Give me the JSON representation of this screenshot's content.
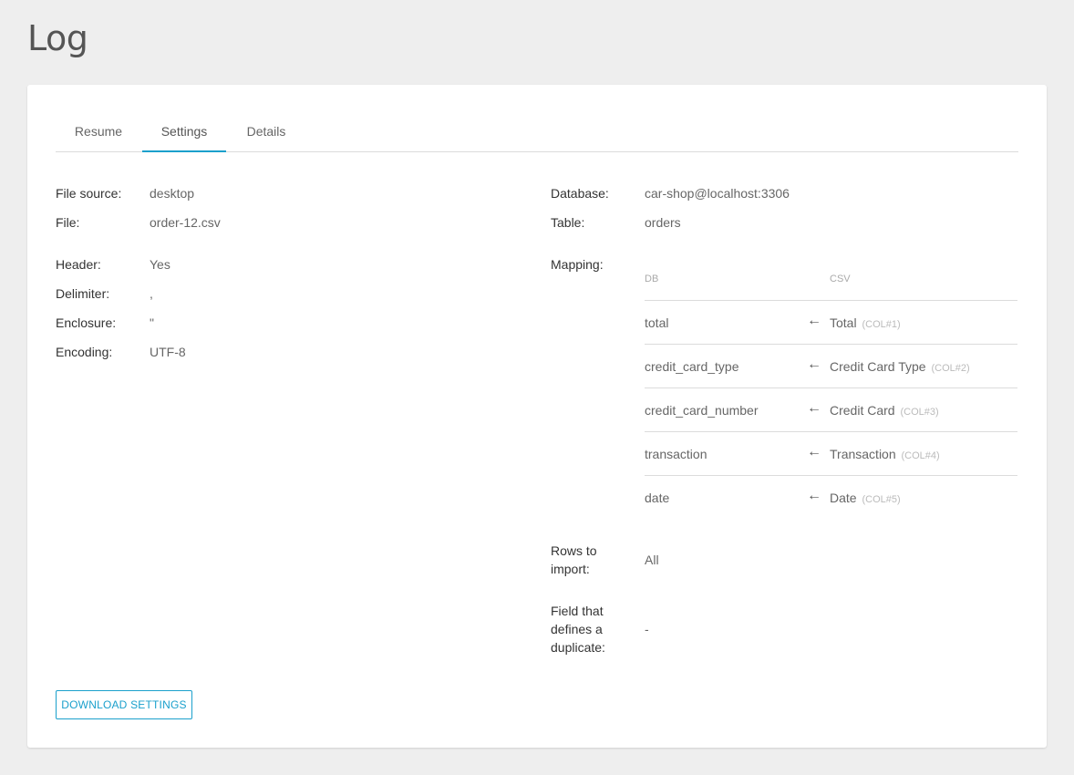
{
  "page": {
    "title": "Log"
  },
  "tabs": [
    {
      "label": "Resume",
      "active": false
    },
    {
      "label": "Settings",
      "active": true
    },
    {
      "label": "Details",
      "active": false
    }
  ],
  "file_settings": {
    "file_source_label": "File source:",
    "file_source_value": "desktop",
    "file_label": "File:",
    "file_value": "order-12.csv",
    "header_label": "Header:",
    "header_value": "Yes",
    "delimiter_label": "Delimiter:",
    "delimiter_value": ",",
    "enclosure_label": "Enclosure:",
    "enclosure_value": "\"",
    "encoding_label": "Encoding:",
    "encoding_value": "UTF-8"
  },
  "db_settings": {
    "database_label": "Database:",
    "database_value": "car-shop@localhost:3306",
    "table_label": "Table:",
    "table_value": "orders",
    "mapping_label": "Mapping:",
    "rows_to_import_label": "Rows to import:",
    "rows_to_import_value": "All",
    "duplicate_field_label": "Field that defines a duplicate:",
    "duplicate_field_value": "-"
  },
  "mapping": {
    "db_header": "DB",
    "csv_header": "CSV",
    "arrow": "←",
    "rows": [
      {
        "db": "total",
        "csv": "Total",
        "col": "(COL#1)"
      },
      {
        "db": "credit_card_type",
        "csv": "Credit Card Type",
        "col": "(COL#2)"
      },
      {
        "db": "credit_card_number",
        "csv": "Credit Card",
        "col": "(COL#3)"
      },
      {
        "db": "transaction",
        "csv": "Transaction",
        "col": "(COL#4)"
      },
      {
        "db": "date",
        "csv": "Date",
        "col": "(COL#5)"
      }
    ]
  },
  "actions": {
    "download_label": "DOWNLOAD SETTINGS"
  },
  "colors": {
    "accent": "#1ba0cc",
    "background": "#eeeeee",
    "card": "#ffffff"
  }
}
